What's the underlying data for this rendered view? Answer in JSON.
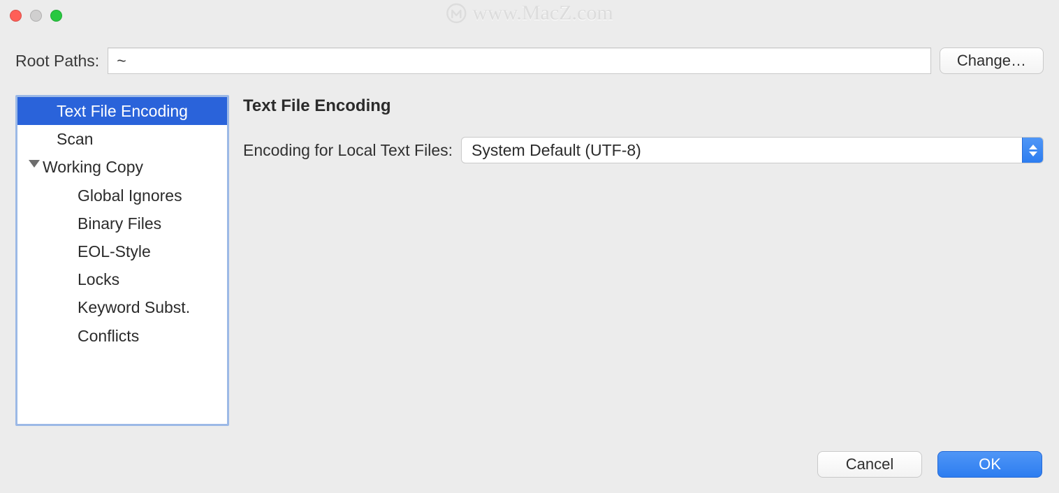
{
  "watermark": {
    "text": "www.MacZ.com"
  },
  "root_paths": {
    "label": "Root Paths:",
    "value": "~",
    "change_label": "Change…"
  },
  "sidebar": {
    "items": [
      {
        "label": "Text File Encoding",
        "type": "leaf",
        "selected": true
      },
      {
        "label": "Scan",
        "type": "leaf"
      },
      {
        "label": "Working Copy",
        "type": "group",
        "expanded": true
      },
      {
        "label": "Global Ignores",
        "type": "sub"
      },
      {
        "label": "Binary Files",
        "type": "sub"
      },
      {
        "label": "EOL-Style",
        "type": "sub"
      },
      {
        "label": "Locks",
        "type": "sub"
      },
      {
        "label": "Keyword Subst.",
        "type": "sub"
      },
      {
        "label": "Conflicts",
        "type": "sub"
      }
    ],
    "selected_index": 0
  },
  "panel": {
    "title": "Text File Encoding",
    "encoding_label": "Encoding for Local Text Files:",
    "encoding_value": "System Default (UTF-8)"
  },
  "footer": {
    "cancel": "Cancel",
    "ok": "OK"
  },
  "colors": {
    "selection": "#2a63da",
    "accent": "#2d7df0"
  }
}
